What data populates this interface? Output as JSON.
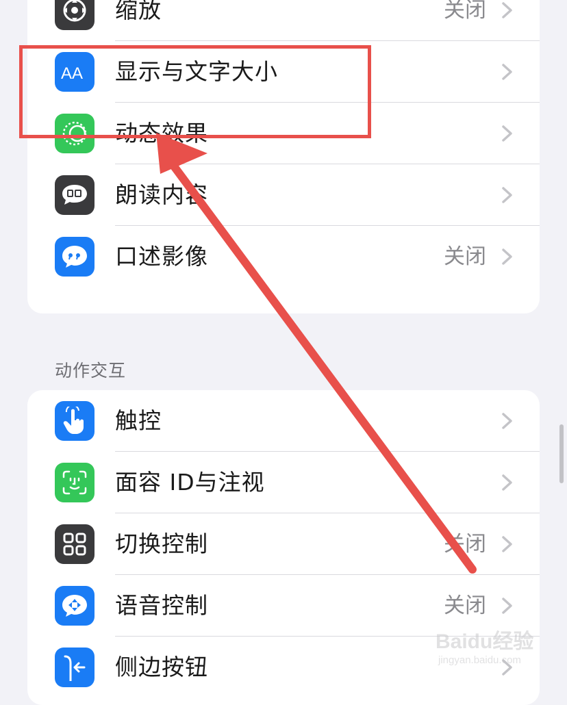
{
  "groups": {
    "vision": {
      "rows": [
        {
          "label": "缩放",
          "value": "关闭",
          "icon": "zoom-icon",
          "color": "#3a3a3c"
        },
        {
          "label": "显示与文字大小",
          "value": "",
          "icon": "text-size-icon",
          "color": "#1a7cf5"
        },
        {
          "label": "动态效果",
          "value": "",
          "icon": "motion-icon",
          "color": "#34c759"
        },
        {
          "label": "朗读内容",
          "value": "",
          "icon": "spoken-content-icon",
          "color": "#3a3a3c"
        },
        {
          "label": "口述影像",
          "value": "关闭",
          "icon": "audio-description-icon",
          "color": "#1a7cf5"
        }
      ]
    },
    "interaction": {
      "header": "动作交互",
      "rows": [
        {
          "label": "触控",
          "value": "",
          "icon": "touch-icon",
          "color": "#1a7cf5"
        },
        {
          "label": "面容 ID与注视",
          "value": "",
          "icon": "face-id-icon",
          "color": "#34c759"
        },
        {
          "label": "切换控制",
          "value": "关闭",
          "icon": "switch-control-icon",
          "color": "#3a3a3c"
        },
        {
          "label": "语音控制",
          "value": "关闭",
          "icon": "voice-control-icon",
          "color": "#1a7cf5"
        },
        {
          "label": "侧边按钮",
          "value": "",
          "icon": "side-button-icon",
          "color": "#1a7cf5"
        }
      ]
    }
  },
  "annotation": {
    "color": "#e8504b"
  },
  "watermark": {
    "logo": "Baidu经验",
    "url": "jingyan.baidu.com"
  }
}
